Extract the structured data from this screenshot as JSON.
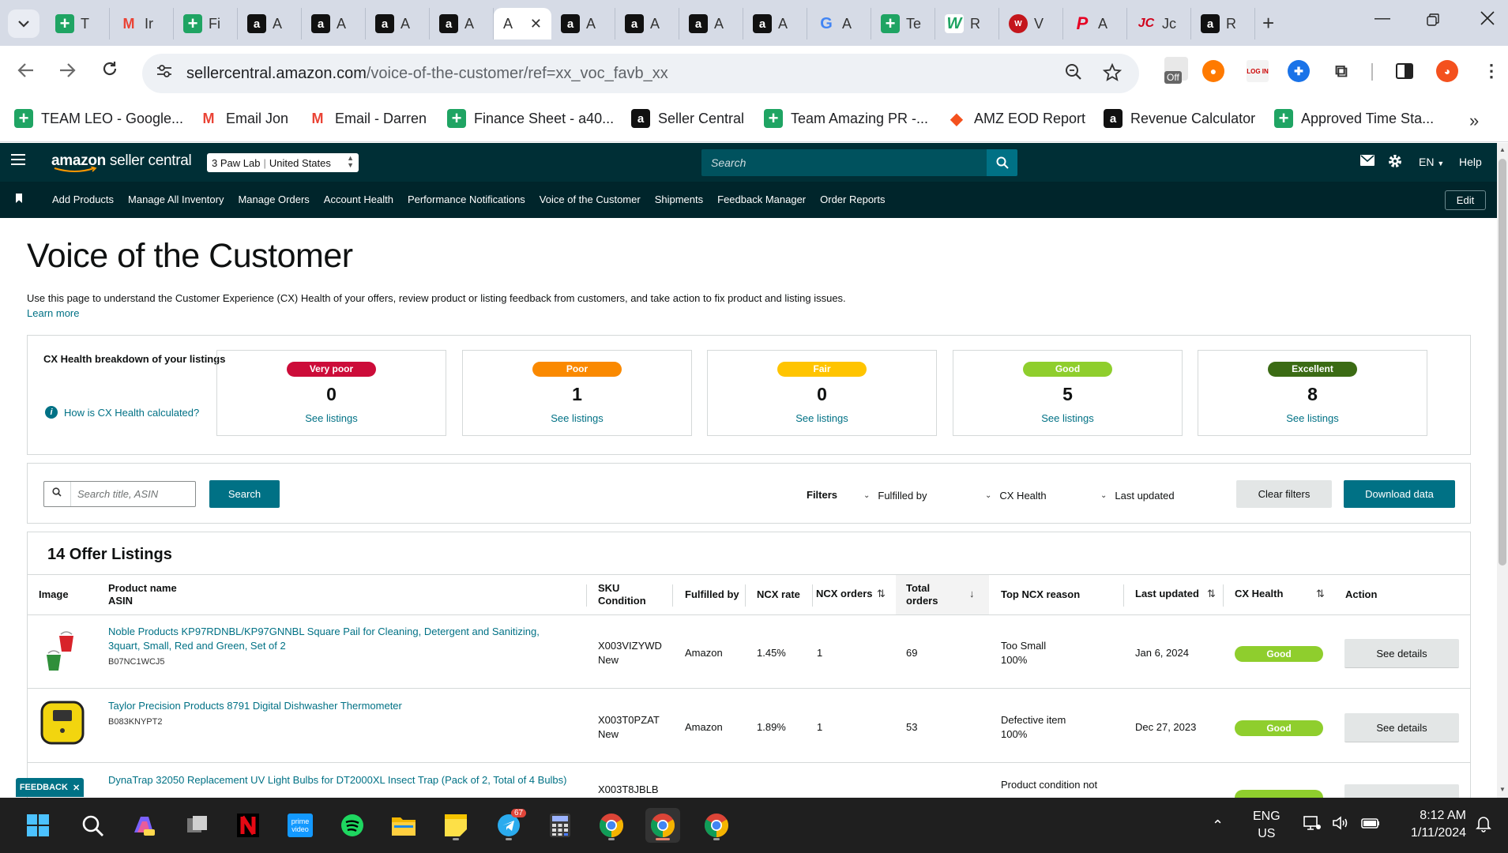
{
  "browser": {
    "tabs": [
      {
        "icon": "sheet-icon",
        "label": "T"
      },
      {
        "icon": "gmail-icon",
        "label": "Ir"
      },
      {
        "icon": "sheet-icon",
        "label": "Fi"
      },
      {
        "icon": "amazon-icon",
        "label": "A"
      },
      {
        "icon": "amazon-icon",
        "label": "A"
      },
      {
        "icon": "amazon-icon",
        "label": "A"
      },
      {
        "icon": "amazon-icon",
        "label": "A"
      },
      {
        "icon": "amazon-icon",
        "label": "A",
        "active": true
      },
      {
        "icon": "amazon-icon",
        "label": "A"
      },
      {
        "icon": "amazon-icon",
        "label": "A"
      },
      {
        "icon": "amazon-icon",
        "label": "A"
      },
      {
        "icon": "amazon-icon",
        "label": "A"
      },
      {
        "icon": "google-icon",
        "label": "A"
      },
      {
        "icon": "sheet-icon",
        "label": "Te"
      },
      {
        "icon": "w-icon",
        "label": "R"
      },
      {
        "icon": "walgreens-icon",
        "label": "V"
      },
      {
        "icon": "pinterest-icon",
        "label": "A"
      },
      {
        "icon": "jc-icon",
        "label": "Jc"
      },
      {
        "icon": "amazon-icon",
        "label": "R"
      }
    ],
    "url_host": "sellercentral.amazon.com",
    "url_path": "/voice-of-the-customer/ref=xx_voc_favb_xx",
    "bookmarks": [
      {
        "icon": "sheet-icon",
        "label": "TEAM LEO - Google..."
      },
      {
        "icon": "gmail-icon",
        "label": "Email Jon"
      },
      {
        "icon": "gmail-icon",
        "label": "Email - Darren"
      },
      {
        "icon": "sheet-icon",
        "label": "Finance Sheet - a40..."
      },
      {
        "icon": "amazon-icon",
        "label": "Seller Central"
      },
      {
        "icon": "sheet-icon",
        "label": "Team Amazing PR -..."
      },
      {
        "icon": "report-icon",
        "label": "AMZ EOD Report"
      },
      {
        "icon": "amazon-icon",
        "label": "Revenue Calculator"
      },
      {
        "icon": "sheet-icon",
        "label": "Approved Time Sta..."
      }
    ],
    "extension_off_label": "Off"
  },
  "sc_header": {
    "logo_bold": "amazon",
    "logo_rest": " seller central",
    "store": "3 Paw Lab",
    "marketplace": "United States",
    "search_placeholder": "Search",
    "lang": "EN",
    "help": "Help",
    "nav_links": [
      "Add Products",
      "Manage All Inventory",
      "Manage Orders",
      "Account Health",
      "Performance Notifications",
      "Voice of the Customer",
      "Shipments",
      "Feedback Manager",
      "Order Reports"
    ],
    "edit": "Edit"
  },
  "page": {
    "title": "Voice of the Customer",
    "description": "Use this page to understand the Customer Experience (CX) Health of your offers, review product or listing feedback from customers, and take action to fix product and listing issues.",
    "learn_more": "Learn more"
  },
  "cx_breakdown": {
    "title": "CX Health breakdown of your listings",
    "how_link": "How is CX Health calculated?",
    "cards": [
      {
        "label": "Very poor",
        "count": "0",
        "link": "See listings",
        "color": "#cc0c39",
        "text_color": "#ffffff"
      },
      {
        "label": "Poor",
        "count": "1",
        "link": "See listings",
        "color": "#fa8900",
        "text_color": "#ffffff"
      },
      {
        "label": "Fair",
        "count": "0",
        "link": "See listings",
        "color": "#ffc400",
        "text_color": "#ffffff"
      },
      {
        "label": "Good",
        "count": "5",
        "link": "See listings",
        "color": "#8fce2d",
        "text_color": "#ffffff"
      },
      {
        "label": "Excellent",
        "count": "8",
        "link": "See listings",
        "color": "#3b6b14",
        "text_color": "#ffffff"
      }
    ]
  },
  "filters": {
    "search_placeholder": "Search title, ASIN",
    "search_button": "Search",
    "label": "Filters",
    "dropdowns": [
      "Fulfilled by",
      "CX Health",
      "Last updated"
    ],
    "clear": "Clear filters",
    "download": "Download data"
  },
  "listings": {
    "title": "14 Offer Listings",
    "headers": {
      "image": "Image",
      "product_name": "Product name",
      "asin": "ASIN",
      "sku": "SKU",
      "condition": "Condition",
      "fulfilled_by": "Fulfilled by",
      "ncx_rate": "NCX rate",
      "ncx_orders": "NCX orders",
      "total_orders_1": "Total",
      "total_orders_2": "orders",
      "top_reason": "Top NCX reason",
      "last_updated": "Last updated",
      "cx_health": "CX Health",
      "action": "Action"
    },
    "rows": [
      {
        "product_line1": "Noble Products KP97RDNBL/KP97GNNBL Square Pail for Cleaning, Detergent and Sanitizing,",
        "product_line2": "3quart, Small, Red and Green, Set of 2",
        "asin": "B07NC1WCJ5",
        "sku": "X003VIZYWD",
        "condition": "New",
        "fulfilled_by": "Amazon",
        "ncx_rate": "1.45%",
        "ncx_orders": "1",
        "total_orders": "69",
        "reason": "Too Small",
        "reason_pct": "100%",
        "last_updated": "Jan 6, 2024",
        "cx_health": "Good",
        "action": "See details"
      },
      {
        "product_line1": "Taylor Precision Products 8791 Digital Dishwasher Thermometer",
        "product_line2": "",
        "asin": "B083KNYPT2",
        "sku": "X003T0PZAT",
        "condition": "New",
        "fulfilled_by": "Amazon",
        "ncx_rate": "1.89%",
        "ncx_orders": "1",
        "total_orders": "53",
        "reason": "Defective item",
        "reason_pct": "100%",
        "last_updated": "Dec 27, 2023",
        "cx_health": "Good",
        "action": "See details"
      },
      {
        "product_line1": "DynaTrap 32050 Replacement UV Light Bulbs for DT2000XL Insect Trap (Pack of 2, Total of 4 Bulbs)",
        "product_line2": "",
        "asin": "",
        "sku": "X003T8JBLB",
        "condition": "",
        "fulfilled_by": "",
        "ncx_rate": "",
        "ncx_orders": "",
        "total_orders": "",
        "reason": "Product condition not",
        "reason_pct": "",
        "last_updated": "",
        "cx_health": "",
        "action": ""
      }
    ]
  },
  "feedback_tab": "FEEDBACK",
  "taskbar": {
    "apps": [
      "start-icon",
      "search-icon",
      "copilot-icon",
      "task-view-icon",
      "netflix-icon",
      "prime-video-icon",
      "spotify-icon",
      "file-explorer-icon",
      "sticky-notes-icon",
      "telegram-icon",
      "calculator-icon",
      "chrome-icon",
      "chrome-icon",
      "chrome-icon"
    ],
    "telegram_badge": "67",
    "lang1": "ENG",
    "lang2": "US",
    "time": "8:12 AM",
    "date": "1/11/2024"
  }
}
